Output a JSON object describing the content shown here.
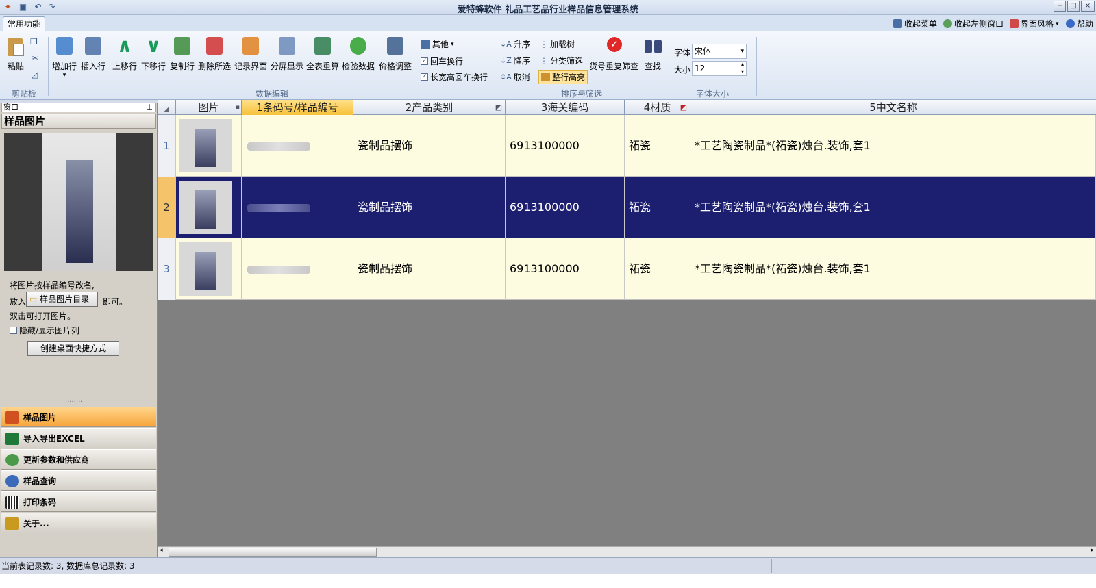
{
  "window": {
    "title": "爱特蜂软件 礼品工艺品行业样品信息管理系统",
    "min": "−",
    "max": "□",
    "close": "×"
  },
  "ribbon_tabs": [
    "常用功能"
  ],
  "top_links": [
    "收起菜单",
    "收起左侧窗口",
    "界面风格",
    "帮助"
  ],
  "groups": {
    "clipboard": {
      "label": "剪贴板",
      "paste": "粘贴"
    },
    "edit": {
      "label": "数据编辑",
      "buttons": [
        "增加行",
        "插入行",
        "上移行",
        "下移行",
        "复制行",
        "删除所选",
        "记录界面",
        "分屏显示",
        "全表重算",
        "检验数据",
        "价格调整"
      ],
      "other": "其他",
      "cr_wrap": "回车换行",
      "long_cr_wrap": "长宽高回车换行"
    },
    "sort": {
      "label": "排序与筛选",
      "asc": "升序",
      "desc": "降序",
      "cancel": "取消",
      "load_tree": "加载树",
      "cat_filter": "分类筛选",
      "row_highlight": "整行高亮",
      "dup_filter": "货号重复筛查",
      "find": "查找"
    },
    "font": {
      "label": "字体大小",
      "font_label": "字体",
      "font_value": "宋体",
      "size_label": "大小",
      "size_value": "12"
    }
  },
  "left_panel": {
    "window_label": "窗口",
    "title": "样品图片",
    "hint1": "将图片按样品编号改名,",
    "hint2_pre": "放入",
    "folder_button": "样品图片目录",
    "hint2_post": "即可。",
    "hint3": "双击可打开图片。",
    "toggle_label": "隐藏/显示图片列",
    "shortcut_button": "创建桌面快捷方式",
    "nav": [
      "样品图片",
      "导入导出EXCEL",
      "更新参数和供应商",
      "样品查询",
      "打印条码",
      "关于..."
    ]
  },
  "grid": {
    "columns": [
      "图片",
      "1条码号/样品编号",
      "2产品类别",
      "3海关编码",
      "4材质",
      "5中文名称"
    ],
    "rows": [
      {
        "num": "1",
        "category": "瓷制品摆饰",
        "hs_code": "6913100000",
        "material": "祏瓷",
        "name": "*工艺陶瓷制品*(祏瓷)烛台.装饰,套1"
      },
      {
        "num": "2",
        "category": "瓷制品摆饰",
        "hs_code": "6913100000",
        "material": "祏瓷",
        "name": "*工艺陶瓷制品*(祏瓷)烛台.装饰,套1"
      },
      {
        "num": "3",
        "category": "瓷制品摆饰",
        "hs_code": "6913100000",
        "material": "祏瓷",
        "name": "*工艺陶瓷制品*(祏瓷)烛台.装饰,套1"
      }
    ]
  },
  "status": {
    "text": "当前表记录数: 3, 数据库总记录数: 3"
  },
  "colors": {
    "selected_row": "#1c1f6f",
    "row_bg": "#fefce0",
    "active_nav": "#f7a53a",
    "header_selected": "#f7c13a"
  }
}
